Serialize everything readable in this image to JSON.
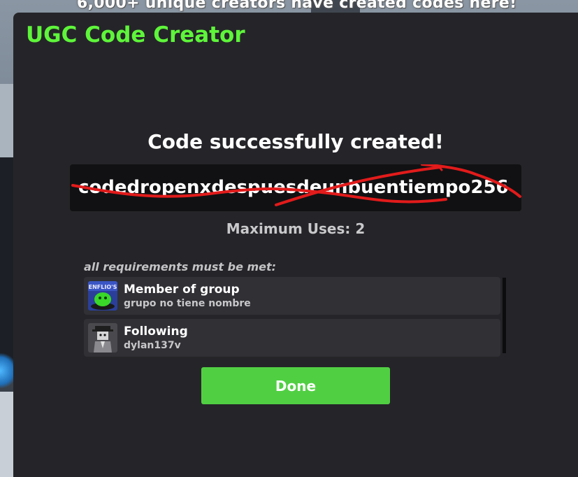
{
  "background": {
    "banner_text": "6,000+ unique creators have created codes here!"
  },
  "modal": {
    "title": "UGC Code Creator",
    "success_message": "Code successfully created!",
    "code_value": "codedropenxdespuesdeunbuentiempo256",
    "max_uses": "Maximum Uses: 2",
    "requirements_label": "all requirements must be met:",
    "requirements": [
      {
        "name": "Member of group",
        "detail": "grupo no tiene nombre",
        "icon": "group-logo-icon"
      },
      {
        "name": "Following",
        "detail": "dylan137v",
        "icon": "user-avatar-icon"
      }
    ],
    "done_label": "Done"
  },
  "colors": {
    "title_green": "#5ef53a",
    "done_green": "#51cf43",
    "modal_bg": "#252529",
    "scribble_red": "#e21b1b"
  }
}
